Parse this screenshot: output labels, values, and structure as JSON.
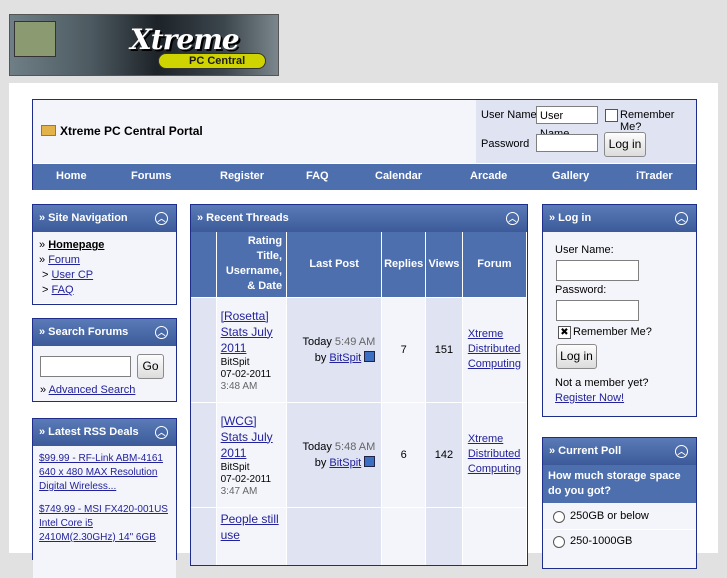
{
  "logo": {
    "line1": "Xtreme",
    "line2": "PC Central"
  },
  "header": {
    "portal_title": "Xtreme PC Central Portal",
    "username_label": "User Name",
    "username_value": "User Name",
    "remember_label": "Remember Me?",
    "password_label": "Password",
    "login_button": "Log in"
  },
  "nav": [
    "Home",
    "Forums",
    "Register",
    "FAQ",
    "Calendar",
    "Arcade",
    "Gallery",
    "iTrader"
  ],
  "site_nav": {
    "title": "» Site Navigation",
    "items": [
      "Homepage",
      "Forum",
      "User CP",
      "FAQ"
    ]
  },
  "search": {
    "title": "» Search Forums",
    "go": "Go",
    "advanced_prefix": "» ",
    "advanced": "Advanced Search"
  },
  "rss": {
    "title": "» Latest RSS Deals",
    "items": [
      {
        "price": "$99.99",
        "text": " - RF-Link ABM-4161 640 x 480 MAX Resolution Digital Wireless..."
      },
      {
        "price": "$749.99",
        "text": " - MSI FX420-001US Intel Core i5 2410M(2.30GHz) 14\" 6GB"
      }
    ]
  },
  "recent": {
    "title": "» Recent Threads",
    "headers": [
      "Rating Title, Username, & Date",
      "Last Post",
      "Replies",
      "Views",
      "Forum"
    ],
    "rows": [
      {
        "title": "[Rosetta] Stats July 2011",
        "user": "BitSpit",
        "date": "07-02-2011",
        "time": "3:48 AM",
        "last_day": "Today",
        "last_time": "5:49 AM",
        "by": "by",
        "last_user": "BitSpit",
        "replies": "7",
        "views": "151",
        "forum": "Xtreme Distributed Computing"
      },
      {
        "title": "[WCG] Stats July 2011",
        "user": "BitSpit",
        "date": "07-02-2011",
        "time": "3:47 AM",
        "last_day": "Today",
        "last_time": "5:48 AM",
        "by": "by",
        "last_user": "BitSpit",
        "replies": "6",
        "views": "142",
        "forum": "Xtreme Distributed Computing"
      },
      {
        "title": "People still use"
      }
    ]
  },
  "login_panel": {
    "title": "» Log in",
    "username_label": "User Name:",
    "password_label": "Password:",
    "remember": "Remember Me?",
    "button": "Log in",
    "not_member": "Not a member yet?",
    "register": "Register Now!"
  },
  "poll": {
    "title": "» Current Poll",
    "question": "How much storage space do you got?",
    "options": [
      "250GB or below",
      "250-1000GB"
    ]
  }
}
